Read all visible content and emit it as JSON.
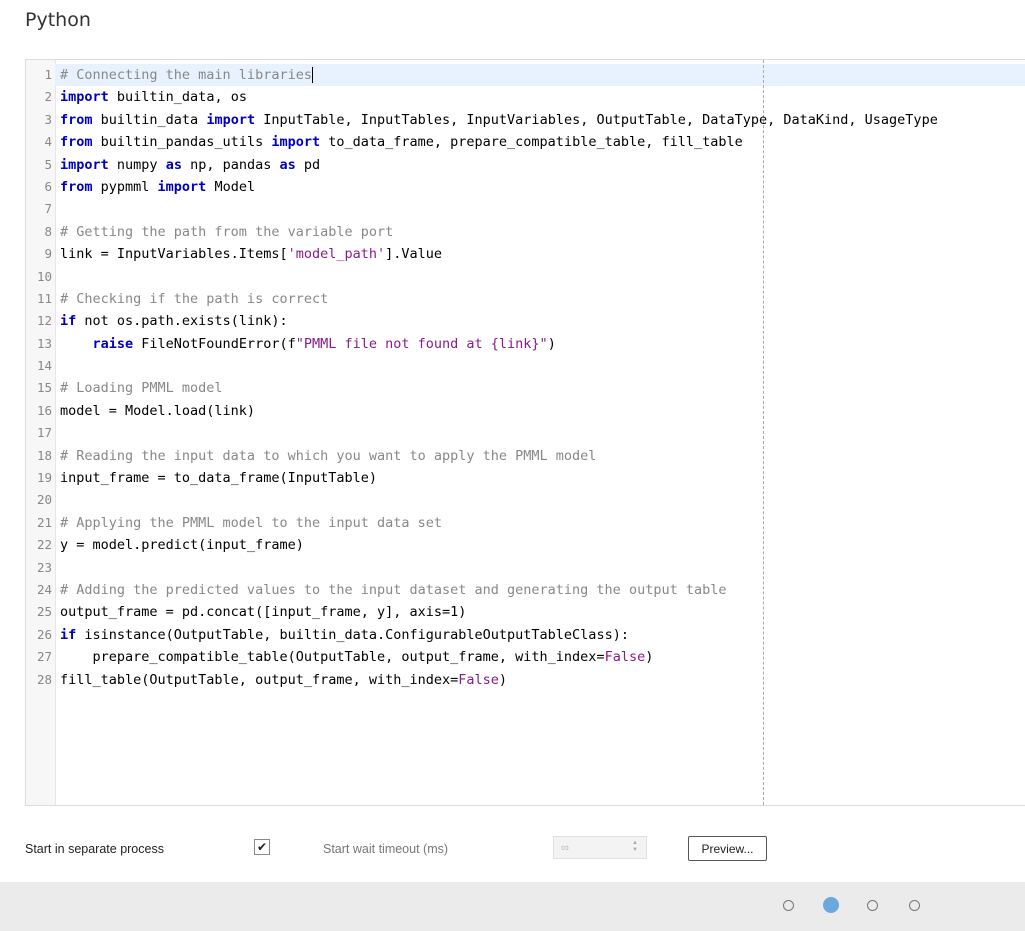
{
  "page": {
    "title": "Python"
  },
  "editor": {
    "lines": [
      [
        {
          "t": "cm",
          "v": "# Connecting the main libraries"
        }
      ],
      [
        {
          "t": "kw",
          "v": "import"
        },
        {
          "t": "",
          "v": " builtin_data, os"
        }
      ],
      [
        {
          "t": "kw",
          "v": "from"
        },
        {
          "t": "",
          "v": " builtin_data "
        },
        {
          "t": "kw",
          "v": "import"
        },
        {
          "t": "",
          "v": " InputTable, InputTables, InputVariables, OutputTable, DataType, DataKind, UsageType"
        }
      ],
      [
        {
          "t": "kw",
          "v": "from"
        },
        {
          "t": "",
          "v": " builtin_pandas_utils "
        },
        {
          "t": "kw",
          "v": "import"
        },
        {
          "t": "",
          "v": " to_data_frame, prepare_compatible_table, fill_table"
        }
      ],
      [
        {
          "t": "kw",
          "v": "import"
        },
        {
          "t": "",
          "v": " numpy "
        },
        {
          "t": "kw",
          "v": "as"
        },
        {
          "t": "",
          "v": " np, pandas "
        },
        {
          "t": "kw",
          "v": "as"
        },
        {
          "t": "",
          "v": " pd"
        }
      ],
      [
        {
          "t": "kw",
          "v": "from"
        },
        {
          "t": "",
          "v": " pypmml "
        },
        {
          "t": "kw",
          "v": "import"
        },
        {
          "t": "",
          "v": " Model"
        }
      ],
      [],
      [
        {
          "t": "cm",
          "v": "# Getting the path from the variable port"
        }
      ],
      [
        {
          "t": "",
          "v": "link = InputVariables.Items["
        },
        {
          "t": "st",
          "v": "'model_path'"
        },
        {
          "t": "",
          "v": "].Value"
        }
      ],
      [],
      [
        {
          "t": "cm",
          "v": "# Checking if the path is correct"
        }
      ],
      [
        {
          "t": "kw",
          "v": "if"
        },
        {
          "t": "",
          "v": " not os.path.exists(link):"
        }
      ],
      [
        {
          "t": "",
          "v": "    "
        },
        {
          "t": "kw",
          "v": "raise"
        },
        {
          "t": "",
          "v": " FileNotFoundError(f"
        },
        {
          "t": "st",
          "v": "\"PMML file not found at {link}\""
        },
        {
          "t": "",
          "v": ")"
        }
      ],
      [],
      [
        {
          "t": "cm",
          "v": "# Loading PMML model"
        }
      ],
      [
        {
          "t": "",
          "v": "model = Model.load(link)"
        }
      ],
      [],
      [
        {
          "t": "cm",
          "v": "# Reading the input data to which you want to apply the PMML model"
        }
      ],
      [
        {
          "t": "",
          "v": "input_frame = to_data_frame(InputTable)"
        }
      ],
      [],
      [
        {
          "t": "cm",
          "v": "# Applying the PMML model to the input data set"
        }
      ],
      [
        {
          "t": "",
          "v": "y = model.predict(input_frame)"
        }
      ],
      [],
      [
        {
          "t": "cm",
          "v": "# Adding the predicted values to the input dataset and generating the output table"
        }
      ],
      [
        {
          "t": "",
          "v": "output_frame = pd.concat([input_frame, y], axis=1)"
        }
      ],
      [
        {
          "t": "kw",
          "v": "if"
        },
        {
          "t": "",
          "v": " isinstance(OutputTable, builtin_data.ConfigurableOutputTableClass):"
        }
      ],
      [
        {
          "t": "",
          "v": "    prepare_compatible_table(OutputTable, output_frame, with_index="
        },
        {
          "t": "nb",
          "v": "False"
        },
        {
          "t": "",
          "v": ")"
        }
      ],
      [
        {
          "t": "",
          "v": "fill_table(OutputTable, output_frame, with_index="
        },
        {
          "t": "nb",
          "v": "False"
        },
        {
          "t": "",
          "v": ")"
        }
      ]
    ]
  },
  "footer": {
    "separate_process_label": "Start in separate process",
    "separate_process_checked": "✔",
    "wait_timeout_label": "Start wait timeout (ms)",
    "wait_timeout_value": "∞",
    "preview_label": "Preview..."
  },
  "pagination": {
    "count": 4,
    "active": 1
  },
  "colors": {
    "accent": "#6aa8e0",
    "keyword": "#0000c0",
    "comment": "#888888",
    "string": "#8a1a8a"
  }
}
